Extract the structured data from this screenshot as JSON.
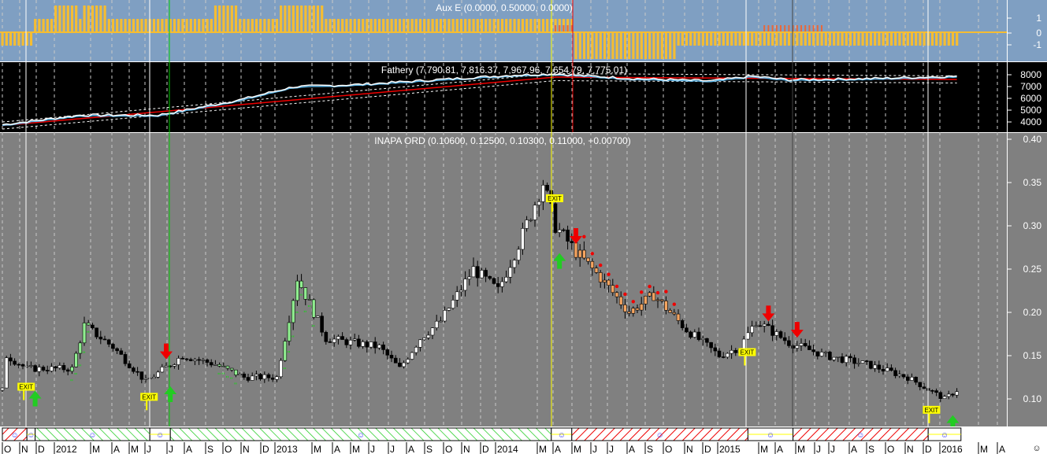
{
  "window": {
    "symbol": "INAPA ORD"
  },
  "colors": {
    "aux_bg": "#7f9fc2",
    "father_bg": "#000000",
    "price_bg": "#808080",
    "aux_bar": "#f5bd32",
    "aux_bar_alt": "#e8683a",
    "accent_yellow": "#ffff00",
    "accent_green": "#00e000"
  },
  "panels": {
    "aux": {
      "title": "Aux E (0.0000, 0.50000, 0.0000)",
      "ticks": [
        "1",
        "0",
        "-1"
      ]
    },
    "father": {
      "title": "Fathery (7,790.81, 7,816.37, 7,967.96, 7,654.79, 7,775.01)",
      "ticks": [
        "8000",
        "7000",
        "6000",
        "5000",
        "4000"
      ]
    },
    "price": {
      "title": "INAPA ORD (0.10600, 0.12500, 0.10300, 0.11000, +0.00700)",
      "ticks": [
        "0.40",
        "0.35",
        "0.30",
        "0.25",
        "0.20",
        "0.15",
        "0.10"
      ]
    }
  },
  "signals": {
    "exit_label": "EXIT"
  },
  "status_icon": "smiley-icon",
  "corner_icon": "smiley-icon",
  "chart_data": {
    "type": "candlestick",
    "x_unit": "week",
    "months": [
      "O",
      "N",
      "D",
      "2012",
      "M",
      "A",
      "M",
      "J",
      "J",
      "A",
      "S",
      "O",
      "N",
      "D",
      "2013",
      "M",
      "A",
      "M",
      "J",
      "J",
      "A",
      "S",
      "O",
      "N",
      "D",
      "2014",
      "M",
      "A",
      "M",
      "J",
      "J",
      "A",
      "S",
      "O",
      "N",
      "D",
      "2015",
      "M",
      "A",
      "M",
      "J",
      "J",
      "A",
      "S",
      "O",
      "N",
      "D",
      "2016",
      "M",
      "A"
    ],
    "price_ylim": [
      0.07,
      0.405
    ],
    "price_close_anchors": [
      [
        1,
        0.15
      ],
      [
        6,
        0.135
      ],
      [
        17,
        0.135
      ],
      [
        20,
        0.185
      ],
      [
        27,
        0.16
      ],
      [
        35,
        0.12
      ],
      [
        44,
        0.15
      ],
      [
        52,
        0.14
      ],
      [
        59,
        0.125
      ],
      [
        67,
        0.125
      ],
      [
        72,
        0.24
      ],
      [
        79,
        0.17
      ],
      [
        92,
        0.16
      ],
      [
        97,
        0.135
      ],
      [
        102,
        0.17
      ],
      [
        107,
        0.19
      ],
      [
        115,
        0.25
      ],
      [
        121,
        0.225
      ],
      [
        127,
        0.29
      ],
      [
        132,
        0.35
      ],
      [
        135,
        0.3
      ],
      [
        140,
        0.27
      ],
      [
        146,
        0.24
      ],
      [
        153,
        0.2
      ],
      [
        159,
        0.22
      ],
      [
        167,
        0.18
      ],
      [
        175,
        0.15
      ],
      [
        180,
        0.16
      ],
      [
        184,
        0.19
      ],
      [
        192,
        0.165
      ],
      [
        201,
        0.15
      ],
      [
        211,
        0.14
      ],
      [
        221,
        0.125
      ],
      [
        230,
        0.1
      ],
      [
        233,
        0.11
      ]
    ],
    "green_weeks": [
      [
        17,
        21
      ],
      [
        53,
        57
      ],
      [
        69,
        76
      ]
    ],
    "orange_weeks": [
      [
        140,
        165
      ]
    ],
    "father_ylim": [
      3300,
      8700
    ],
    "father_anchors": [
      [
        0,
        3700
      ],
      [
        19,
        4500
      ],
      [
        38,
        4500
      ],
      [
        58,
        5800
      ],
      [
        71,
        6900
      ],
      [
        87,
        7100
      ],
      [
        106,
        7500
      ],
      [
        125,
        7900
      ],
      [
        135,
        8000
      ],
      [
        154,
        7600
      ],
      [
        173,
        7400
      ],
      [
        183,
        7800
      ],
      [
        192,
        7500
      ],
      [
        212,
        7600
      ],
      [
        233,
        7800
      ]
    ],
    "aux_segments": [
      [
        0,
        7,
        -0.5
      ],
      [
        8,
        12,
        0.5
      ],
      [
        13,
        18,
        1
      ],
      [
        19,
        19,
        0.5
      ],
      [
        20,
        25,
        1
      ],
      [
        26,
        51,
        0.5
      ],
      [
        52,
        57,
        1
      ],
      [
        58,
        67,
        0.5
      ],
      [
        68,
        78,
        1
      ],
      [
        79,
        139,
        0.5
      ],
      [
        140,
        164,
        -1
      ],
      [
        165,
        233,
        -0.5
      ]
    ],
    "aux_alt_weeks": [
      [
        135,
        139
      ],
      [
        186,
        200
      ]
    ],
    "sell_arrows": [
      40,
      140,
      187,
      194
    ],
    "buy_arrows": [
      8,
      41,
      136,
      232
    ],
    "exit_marks": [
      6,
      36,
      135,
      182,
      227
    ],
    "regime_segments": [
      [
        0,
        6,
        "bear"
      ],
      [
        6,
        8,
        "neutral"
      ],
      [
        8,
        36,
        "bull"
      ],
      [
        36,
        41,
        "neutral"
      ],
      [
        41,
        134,
        "bull"
      ],
      [
        134,
        139,
        "neutral"
      ],
      [
        139,
        182,
        "bear"
      ],
      [
        182,
        193,
        "neutral"
      ],
      [
        193,
        226,
        "bear"
      ],
      [
        226,
        234,
        "neutral"
      ]
    ]
  }
}
